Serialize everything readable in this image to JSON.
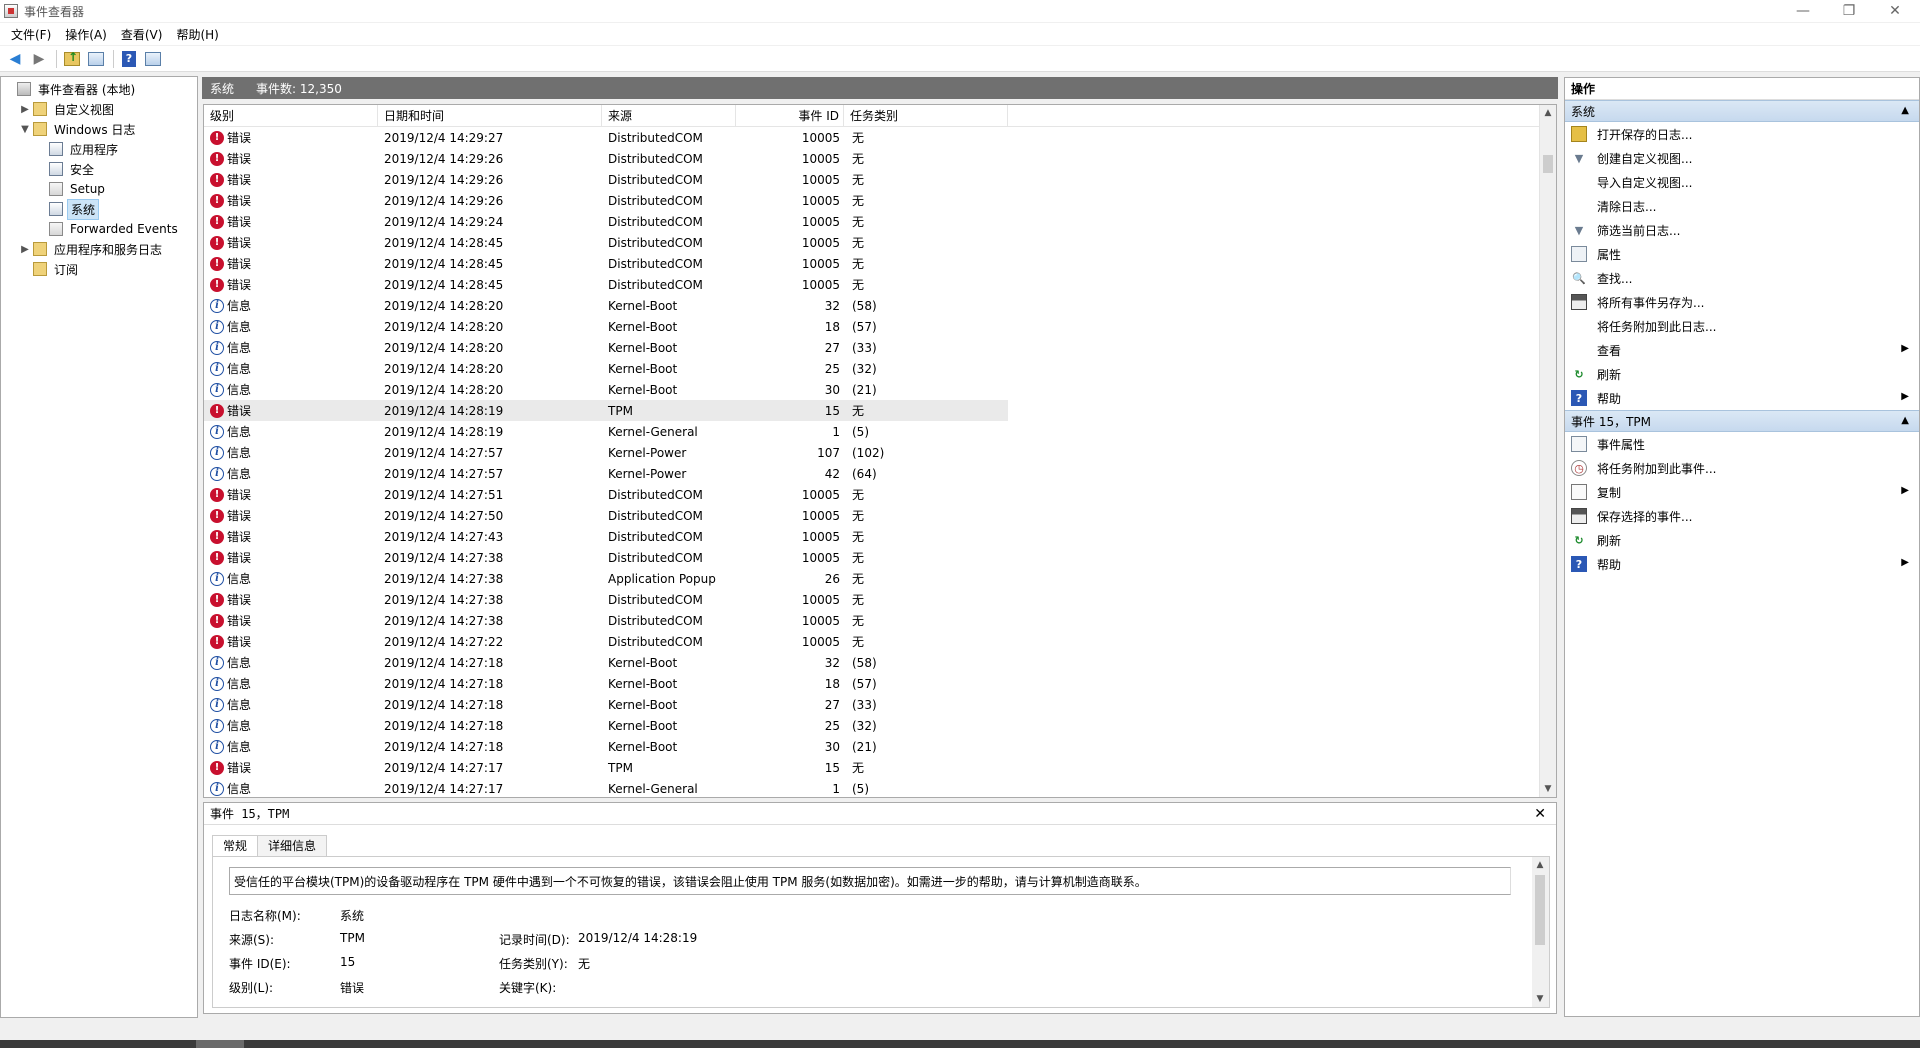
{
  "window": {
    "title": "事件查看器",
    "controls": {
      "minimize": "—",
      "restore": "❐",
      "close": "✕"
    }
  },
  "menu": [
    "文件(F)",
    "操作(A)",
    "查看(V)",
    "帮助(H)"
  ],
  "tree": [
    {
      "label": "事件查看器 (本地)",
      "indent": 0,
      "expander": "",
      "icon": "root",
      "icon_name": "event-viewer-icon"
    },
    {
      "label": "自定义视图",
      "indent": 1,
      "expander": "▶",
      "icon": "folder",
      "icon_name": "folder-icon"
    },
    {
      "label": "Windows 日志",
      "indent": 1,
      "expander": "▼",
      "icon": "folder",
      "icon_name": "folder-icon"
    },
    {
      "label": "应用程序",
      "indent": 2,
      "expander": "",
      "icon": "log",
      "icon_name": "log-icon"
    },
    {
      "label": "安全",
      "indent": 2,
      "expander": "",
      "icon": "log",
      "icon_name": "log-icon"
    },
    {
      "label": "Setup",
      "indent": 2,
      "expander": "",
      "icon": "sub",
      "icon_name": "log-icon"
    },
    {
      "label": "系统",
      "indent": 2,
      "expander": "",
      "icon": "log",
      "icon_name": "log-icon",
      "selected": true
    },
    {
      "label": "Forwarded Events",
      "indent": 2,
      "expander": "",
      "icon": "sub",
      "icon_name": "log-icon"
    },
    {
      "label": "应用程序和服务日志",
      "indent": 1,
      "expander": "▶",
      "icon": "folder",
      "icon_name": "folder-icon"
    },
    {
      "label": "订阅",
      "indent": 1,
      "expander": "",
      "icon": "folder",
      "icon_name": "subscription-icon"
    }
  ],
  "center": {
    "log_name": "系统",
    "event_count": "事件数: 12,350",
    "columns": {
      "level": "级别",
      "date": "日期和时间",
      "source": "来源",
      "id": "事件 ID",
      "task": "任务类别"
    },
    "rows": [
      {
        "type": "error",
        "level": "错误",
        "date": "2019/12/4 14:29:27",
        "source": "DistributedCOM",
        "id": "10005",
        "task": "无"
      },
      {
        "type": "error",
        "level": "错误",
        "date": "2019/12/4 14:29:26",
        "source": "DistributedCOM",
        "id": "10005",
        "task": "无"
      },
      {
        "type": "error",
        "level": "错误",
        "date": "2019/12/4 14:29:26",
        "source": "DistributedCOM",
        "id": "10005",
        "task": "无"
      },
      {
        "type": "error",
        "level": "错误",
        "date": "2019/12/4 14:29:26",
        "source": "DistributedCOM",
        "id": "10005",
        "task": "无"
      },
      {
        "type": "error",
        "level": "错误",
        "date": "2019/12/4 14:29:24",
        "source": "DistributedCOM",
        "id": "10005",
        "task": "无"
      },
      {
        "type": "error",
        "level": "错误",
        "date": "2019/12/4 14:28:45",
        "source": "DistributedCOM",
        "id": "10005",
        "task": "无"
      },
      {
        "type": "error",
        "level": "错误",
        "date": "2019/12/4 14:28:45",
        "source": "DistributedCOM",
        "id": "10005",
        "task": "无"
      },
      {
        "type": "error",
        "level": "错误",
        "date": "2019/12/4 14:28:45",
        "source": "DistributedCOM",
        "id": "10005",
        "task": "无"
      },
      {
        "type": "info",
        "level": "信息",
        "date": "2019/12/4 14:28:20",
        "source": "Kernel-Boot",
        "id": "32",
        "task": "(58)"
      },
      {
        "type": "info",
        "level": "信息",
        "date": "2019/12/4 14:28:20",
        "source": "Kernel-Boot",
        "id": "18",
        "task": "(57)"
      },
      {
        "type": "info",
        "level": "信息",
        "date": "2019/12/4 14:28:20",
        "source": "Kernel-Boot",
        "id": "27",
        "task": "(33)"
      },
      {
        "type": "info",
        "level": "信息",
        "date": "2019/12/4 14:28:20",
        "source": "Kernel-Boot",
        "id": "25",
        "task": "(32)"
      },
      {
        "type": "info",
        "level": "信息",
        "date": "2019/12/4 14:28:20",
        "source": "Kernel-Boot",
        "id": "30",
        "task": "(21)"
      },
      {
        "type": "error",
        "level": "错误",
        "date": "2019/12/4 14:28:19",
        "source": "TPM",
        "id": "15",
        "task": "无",
        "selected": true
      },
      {
        "type": "info",
        "level": "信息",
        "date": "2019/12/4 14:28:19",
        "source": "Kernel-General",
        "id": "1",
        "task": "(5)"
      },
      {
        "type": "info",
        "level": "信息",
        "date": "2019/12/4 14:27:57",
        "source": "Kernel-Power",
        "id": "107",
        "task": "(102)"
      },
      {
        "type": "info",
        "level": "信息",
        "date": "2019/12/4 14:27:57",
        "source": "Kernel-Power",
        "id": "42",
        "task": "(64)"
      },
      {
        "type": "error",
        "level": "错误",
        "date": "2019/12/4 14:27:51",
        "source": "DistributedCOM",
        "id": "10005",
        "task": "无"
      },
      {
        "type": "error",
        "level": "错误",
        "date": "2019/12/4 14:27:50",
        "source": "DistributedCOM",
        "id": "10005",
        "task": "无"
      },
      {
        "type": "error",
        "level": "错误",
        "date": "2019/12/4 14:27:43",
        "source": "DistributedCOM",
        "id": "10005",
        "task": "无"
      },
      {
        "type": "error",
        "level": "错误",
        "date": "2019/12/4 14:27:38",
        "source": "DistributedCOM",
        "id": "10005",
        "task": "无"
      },
      {
        "type": "info",
        "level": "信息",
        "date": "2019/12/4 14:27:38",
        "source": "Application Popup",
        "id": "26",
        "task": "无"
      },
      {
        "type": "error",
        "level": "错误",
        "date": "2019/12/4 14:27:38",
        "source": "DistributedCOM",
        "id": "10005",
        "task": "无"
      },
      {
        "type": "error",
        "level": "错误",
        "date": "2019/12/4 14:27:38",
        "source": "DistributedCOM",
        "id": "10005",
        "task": "无"
      },
      {
        "type": "error",
        "level": "错误",
        "date": "2019/12/4 14:27:22",
        "source": "DistributedCOM",
        "id": "10005",
        "task": "无"
      },
      {
        "type": "info",
        "level": "信息",
        "date": "2019/12/4 14:27:18",
        "source": "Kernel-Boot",
        "id": "32",
        "task": "(58)"
      },
      {
        "type": "info",
        "level": "信息",
        "date": "2019/12/4 14:27:18",
        "source": "Kernel-Boot",
        "id": "18",
        "task": "(57)"
      },
      {
        "type": "info",
        "level": "信息",
        "date": "2019/12/4 14:27:18",
        "source": "Kernel-Boot",
        "id": "27",
        "task": "(33)"
      },
      {
        "type": "info",
        "level": "信息",
        "date": "2019/12/4 14:27:18",
        "source": "Kernel-Boot",
        "id": "25",
        "task": "(32)"
      },
      {
        "type": "info",
        "level": "信息",
        "date": "2019/12/4 14:27:18",
        "source": "Kernel-Boot",
        "id": "30",
        "task": "(21)"
      },
      {
        "type": "error",
        "level": "错误",
        "date": "2019/12/4 14:27:17",
        "source": "TPM",
        "id": "15",
        "task": "无"
      },
      {
        "type": "info",
        "level": "信息",
        "date": "2019/12/4 14:27:17",
        "source": "Kernel-General",
        "id": "1",
        "task": "(5)"
      }
    ]
  },
  "detail": {
    "title": "事件 15，TPM",
    "close": "✕",
    "tabs": [
      "常规",
      "详细信息"
    ],
    "description": "受信任的平台模块(TPM)的设备驱动程序在 TPM 硬件中遇到一个不可恢复的错误，该错误会阻止使用 TPM 服务(如数据加密)。如需进一步的帮助，请与计算机制造商联系。",
    "fields": {
      "log_name_label": "日志名称(M):",
      "log_name_value": "系统",
      "source_label": "来源(S):",
      "source_value": "TPM",
      "logged_label": "记录时间(D):",
      "logged_value": "2019/12/4 14:28:19",
      "event_id_label": "事件 ID(E):",
      "event_id_value": "15",
      "task_label": "任务类别(Y):",
      "task_value": "无",
      "level_label": "级别(L):",
      "level_value": "错误",
      "keywords_label": "关键字(K):"
    }
  },
  "actions": {
    "header": "操作",
    "sections": [
      {
        "title": "系统",
        "items": [
          {
            "label": "打开保存的日志...",
            "icon": "i-open",
            "icon_name": "open-folder-icon",
            "glyph": ""
          },
          {
            "label": "创建自定义视图...",
            "icon": "i-filter",
            "icon_name": "filter-icon",
            "glyph": "▼"
          },
          {
            "label": "导入自定义视图...",
            "icon": "blank",
            "icon_name": "blank-icon",
            "glyph": ""
          },
          {
            "label": "清除日志...",
            "icon": "blank",
            "icon_name": "blank-icon",
            "glyph": ""
          },
          {
            "label": "筛选当前日志...",
            "icon": "i-filter",
            "icon_name": "filter-icon",
            "glyph": "▼"
          },
          {
            "label": "属性",
            "icon": "i-props",
            "icon_name": "properties-icon",
            "glyph": ""
          },
          {
            "label": "查找...",
            "icon": "i-find",
            "icon_name": "binoculars-icon",
            "glyph": "🔍"
          },
          {
            "label": "将所有事件另存为...",
            "icon": "i-save",
            "icon_name": "save-icon",
            "glyph": ""
          },
          {
            "label": "将任务附加到此日志...",
            "icon": "blank",
            "icon_name": "blank-icon",
            "glyph": ""
          },
          {
            "label": "查看",
            "icon": "blank",
            "icon_name": "blank-icon",
            "glyph": "",
            "submenu": "▶"
          },
          {
            "label": "刷新",
            "icon": "i-refresh",
            "icon_name": "refresh-icon",
            "glyph": "↻"
          },
          {
            "label": "帮助",
            "icon": "i-help",
            "icon_name": "help-icon",
            "glyph": "?",
            "submenu": "▶"
          }
        ]
      },
      {
        "title": "事件 15，TPM",
        "items": [
          {
            "label": "事件属性",
            "icon": "i-event",
            "icon_name": "event-properties-icon",
            "glyph": ""
          },
          {
            "label": "将任务附加到此事件...",
            "icon": "i-task",
            "icon_name": "task-icon",
            "glyph": "◷"
          },
          {
            "label": "复制",
            "icon": "i-copy",
            "icon_name": "copy-icon",
            "glyph": "",
            "submenu": "▶"
          },
          {
            "label": "保存选择的事件...",
            "icon": "i-save",
            "icon_name": "save-icon",
            "glyph": ""
          },
          {
            "label": "刷新",
            "icon": "i-refresh",
            "icon_name": "refresh-icon",
            "glyph": "↻"
          },
          {
            "label": "帮助",
            "icon": "i-help",
            "icon_name": "help-icon",
            "glyph": "?",
            "submenu": "▶"
          }
        ]
      }
    ]
  }
}
